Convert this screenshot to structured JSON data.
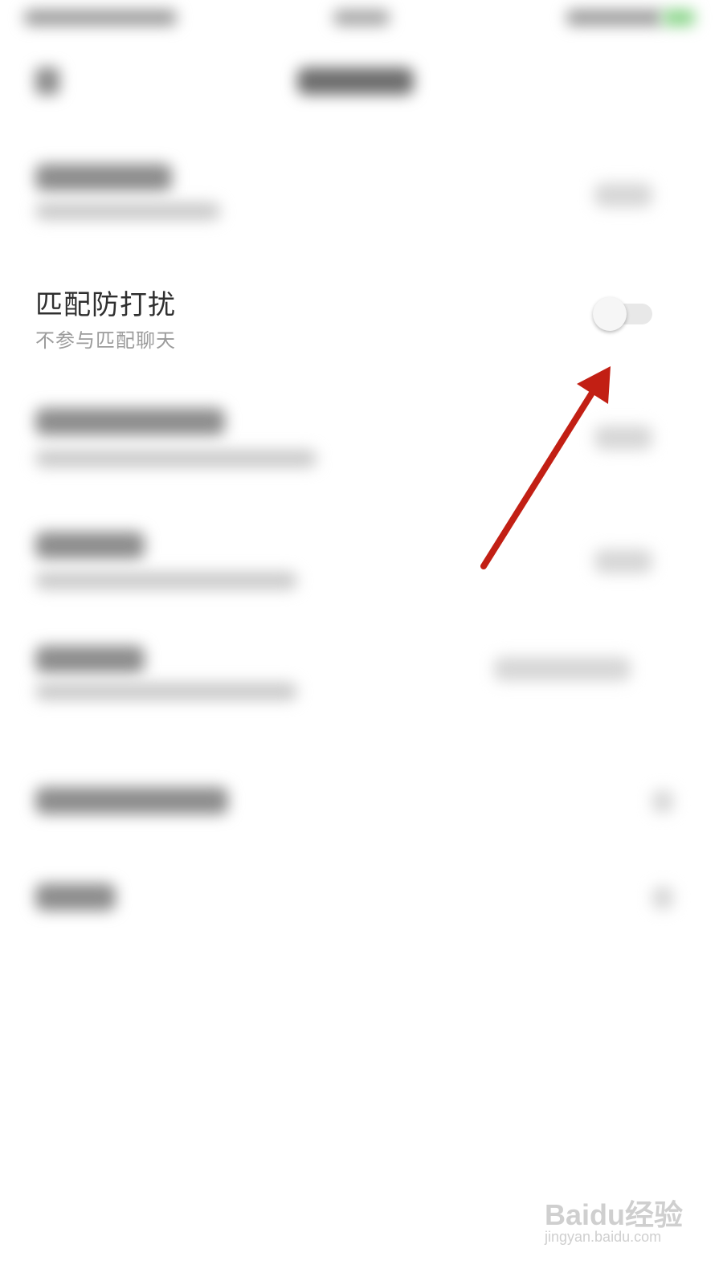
{
  "settings": {
    "match_dnd": {
      "title": "匹配防打扰",
      "subtitle": "不参与匹配聊天",
      "toggle_on": false
    }
  },
  "colors": {
    "annotation_arrow": "#c21f14",
    "toggle_track": "#e8e8e8",
    "toggle_knob": "#f6f6f6"
  },
  "watermark": {
    "brand": "Baidu经验",
    "url": "jingyan.baidu.com"
  }
}
